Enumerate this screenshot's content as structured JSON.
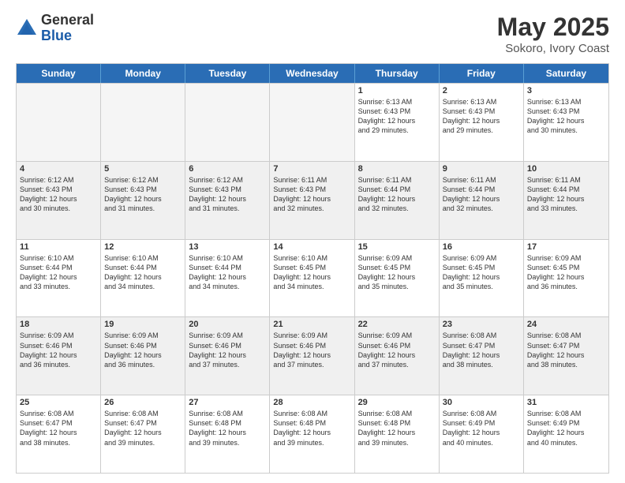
{
  "logo": {
    "general": "General",
    "blue": "Blue"
  },
  "title": "May 2025",
  "location": "Sokoro, Ivory Coast",
  "days_of_week": [
    "Sunday",
    "Monday",
    "Tuesday",
    "Wednesday",
    "Thursday",
    "Friday",
    "Saturday"
  ],
  "weeks": [
    [
      {
        "day": "",
        "info": ""
      },
      {
        "day": "",
        "info": ""
      },
      {
        "day": "",
        "info": ""
      },
      {
        "day": "",
        "info": ""
      },
      {
        "day": "1",
        "info": "Sunrise: 6:13 AM\nSunset: 6:43 PM\nDaylight: 12 hours\nand 29 minutes."
      },
      {
        "day": "2",
        "info": "Sunrise: 6:13 AM\nSunset: 6:43 PM\nDaylight: 12 hours\nand 29 minutes."
      },
      {
        "day": "3",
        "info": "Sunrise: 6:13 AM\nSunset: 6:43 PM\nDaylight: 12 hours\nand 30 minutes."
      }
    ],
    [
      {
        "day": "4",
        "info": "Sunrise: 6:12 AM\nSunset: 6:43 PM\nDaylight: 12 hours\nand 30 minutes."
      },
      {
        "day": "5",
        "info": "Sunrise: 6:12 AM\nSunset: 6:43 PM\nDaylight: 12 hours\nand 31 minutes."
      },
      {
        "day": "6",
        "info": "Sunrise: 6:12 AM\nSunset: 6:43 PM\nDaylight: 12 hours\nand 31 minutes."
      },
      {
        "day": "7",
        "info": "Sunrise: 6:11 AM\nSunset: 6:43 PM\nDaylight: 12 hours\nand 32 minutes."
      },
      {
        "day": "8",
        "info": "Sunrise: 6:11 AM\nSunset: 6:44 PM\nDaylight: 12 hours\nand 32 minutes."
      },
      {
        "day": "9",
        "info": "Sunrise: 6:11 AM\nSunset: 6:44 PM\nDaylight: 12 hours\nand 32 minutes."
      },
      {
        "day": "10",
        "info": "Sunrise: 6:11 AM\nSunset: 6:44 PM\nDaylight: 12 hours\nand 33 minutes."
      }
    ],
    [
      {
        "day": "11",
        "info": "Sunrise: 6:10 AM\nSunset: 6:44 PM\nDaylight: 12 hours\nand 33 minutes."
      },
      {
        "day": "12",
        "info": "Sunrise: 6:10 AM\nSunset: 6:44 PM\nDaylight: 12 hours\nand 34 minutes."
      },
      {
        "day": "13",
        "info": "Sunrise: 6:10 AM\nSunset: 6:44 PM\nDaylight: 12 hours\nand 34 minutes."
      },
      {
        "day": "14",
        "info": "Sunrise: 6:10 AM\nSunset: 6:45 PM\nDaylight: 12 hours\nand 34 minutes."
      },
      {
        "day": "15",
        "info": "Sunrise: 6:09 AM\nSunset: 6:45 PM\nDaylight: 12 hours\nand 35 minutes."
      },
      {
        "day": "16",
        "info": "Sunrise: 6:09 AM\nSunset: 6:45 PM\nDaylight: 12 hours\nand 35 minutes."
      },
      {
        "day": "17",
        "info": "Sunrise: 6:09 AM\nSunset: 6:45 PM\nDaylight: 12 hours\nand 36 minutes."
      }
    ],
    [
      {
        "day": "18",
        "info": "Sunrise: 6:09 AM\nSunset: 6:46 PM\nDaylight: 12 hours\nand 36 minutes."
      },
      {
        "day": "19",
        "info": "Sunrise: 6:09 AM\nSunset: 6:46 PM\nDaylight: 12 hours\nand 36 minutes."
      },
      {
        "day": "20",
        "info": "Sunrise: 6:09 AM\nSunset: 6:46 PM\nDaylight: 12 hours\nand 37 minutes."
      },
      {
        "day": "21",
        "info": "Sunrise: 6:09 AM\nSunset: 6:46 PM\nDaylight: 12 hours\nand 37 minutes."
      },
      {
        "day": "22",
        "info": "Sunrise: 6:09 AM\nSunset: 6:46 PM\nDaylight: 12 hours\nand 37 minutes."
      },
      {
        "day": "23",
        "info": "Sunrise: 6:08 AM\nSunset: 6:47 PM\nDaylight: 12 hours\nand 38 minutes."
      },
      {
        "day": "24",
        "info": "Sunrise: 6:08 AM\nSunset: 6:47 PM\nDaylight: 12 hours\nand 38 minutes."
      }
    ],
    [
      {
        "day": "25",
        "info": "Sunrise: 6:08 AM\nSunset: 6:47 PM\nDaylight: 12 hours\nand 38 minutes."
      },
      {
        "day": "26",
        "info": "Sunrise: 6:08 AM\nSunset: 6:47 PM\nDaylight: 12 hours\nand 39 minutes."
      },
      {
        "day": "27",
        "info": "Sunrise: 6:08 AM\nSunset: 6:48 PM\nDaylight: 12 hours\nand 39 minutes."
      },
      {
        "day": "28",
        "info": "Sunrise: 6:08 AM\nSunset: 6:48 PM\nDaylight: 12 hours\nand 39 minutes."
      },
      {
        "day": "29",
        "info": "Sunrise: 6:08 AM\nSunset: 6:48 PM\nDaylight: 12 hours\nand 39 minutes."
      },
      {
        "day": "30",
        "info": "Sunrise: 6:08 AM\nSunset: 6:49 PM\nDaylight: 12 hours\nand 40 minutes."
      },
      {
        "day": "31",
        "info": "Sunrise: 6:08 AM\nSunset: 6:49 PM\nDaylight: 12 hours\nand 40 minutes."
      }
    ]
  ]
}
